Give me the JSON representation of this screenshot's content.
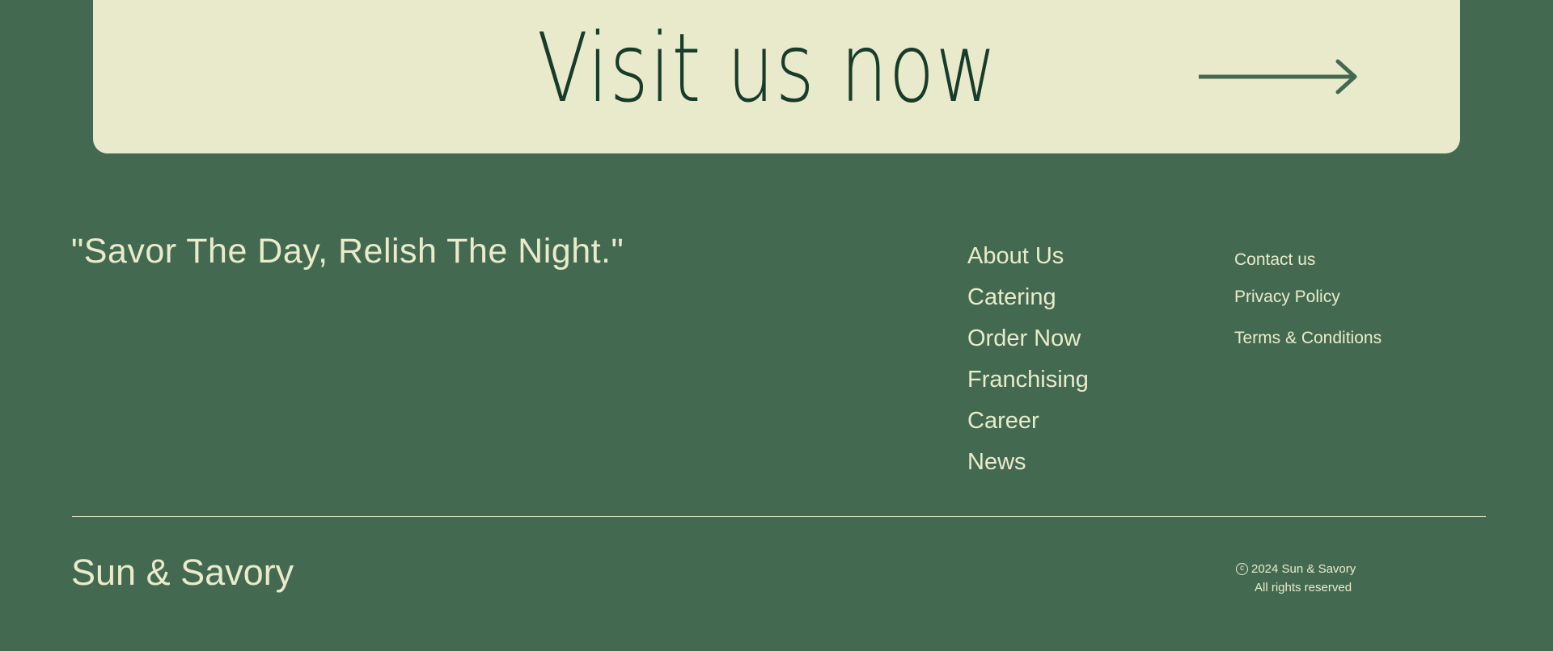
{
  "cta": {
    "title": "Visit us now",
    "arrow_icon": "arrow-right-icon"
  },
  "footer": {
    "tagline": "\"Savor The Day, Relish The Night.\"",
    "nav": [
      {
        "label": "About Us"
      },
      {
        "label": "Catering"
      },
      {
        "label": "Order Now"
      },
      {
        "label": "Franchising"
      },
      {
        "label": "Career"
      },
      {
        "label": "News"
      }
    ],
    "legal": [
      {
        "label": "Contact us"
      },
      {
        "label": "Privacy Policy"
      },
      {
        "label": "Terms & Conditions"
      }
    ],
    "brand": "Sun & Savory",
    "copyright_line1": "2024 Sun & Savory",
    "copyright_line2": "All rights reserved",
    "copyright_icon": "copyright-icon"
  },
  "colors": {
    "background": "#436a51",
    "card": "#e9eacb",
    "dark_green": "#173c29",
    "cream_text": "#e9ebcb"
  }
}
